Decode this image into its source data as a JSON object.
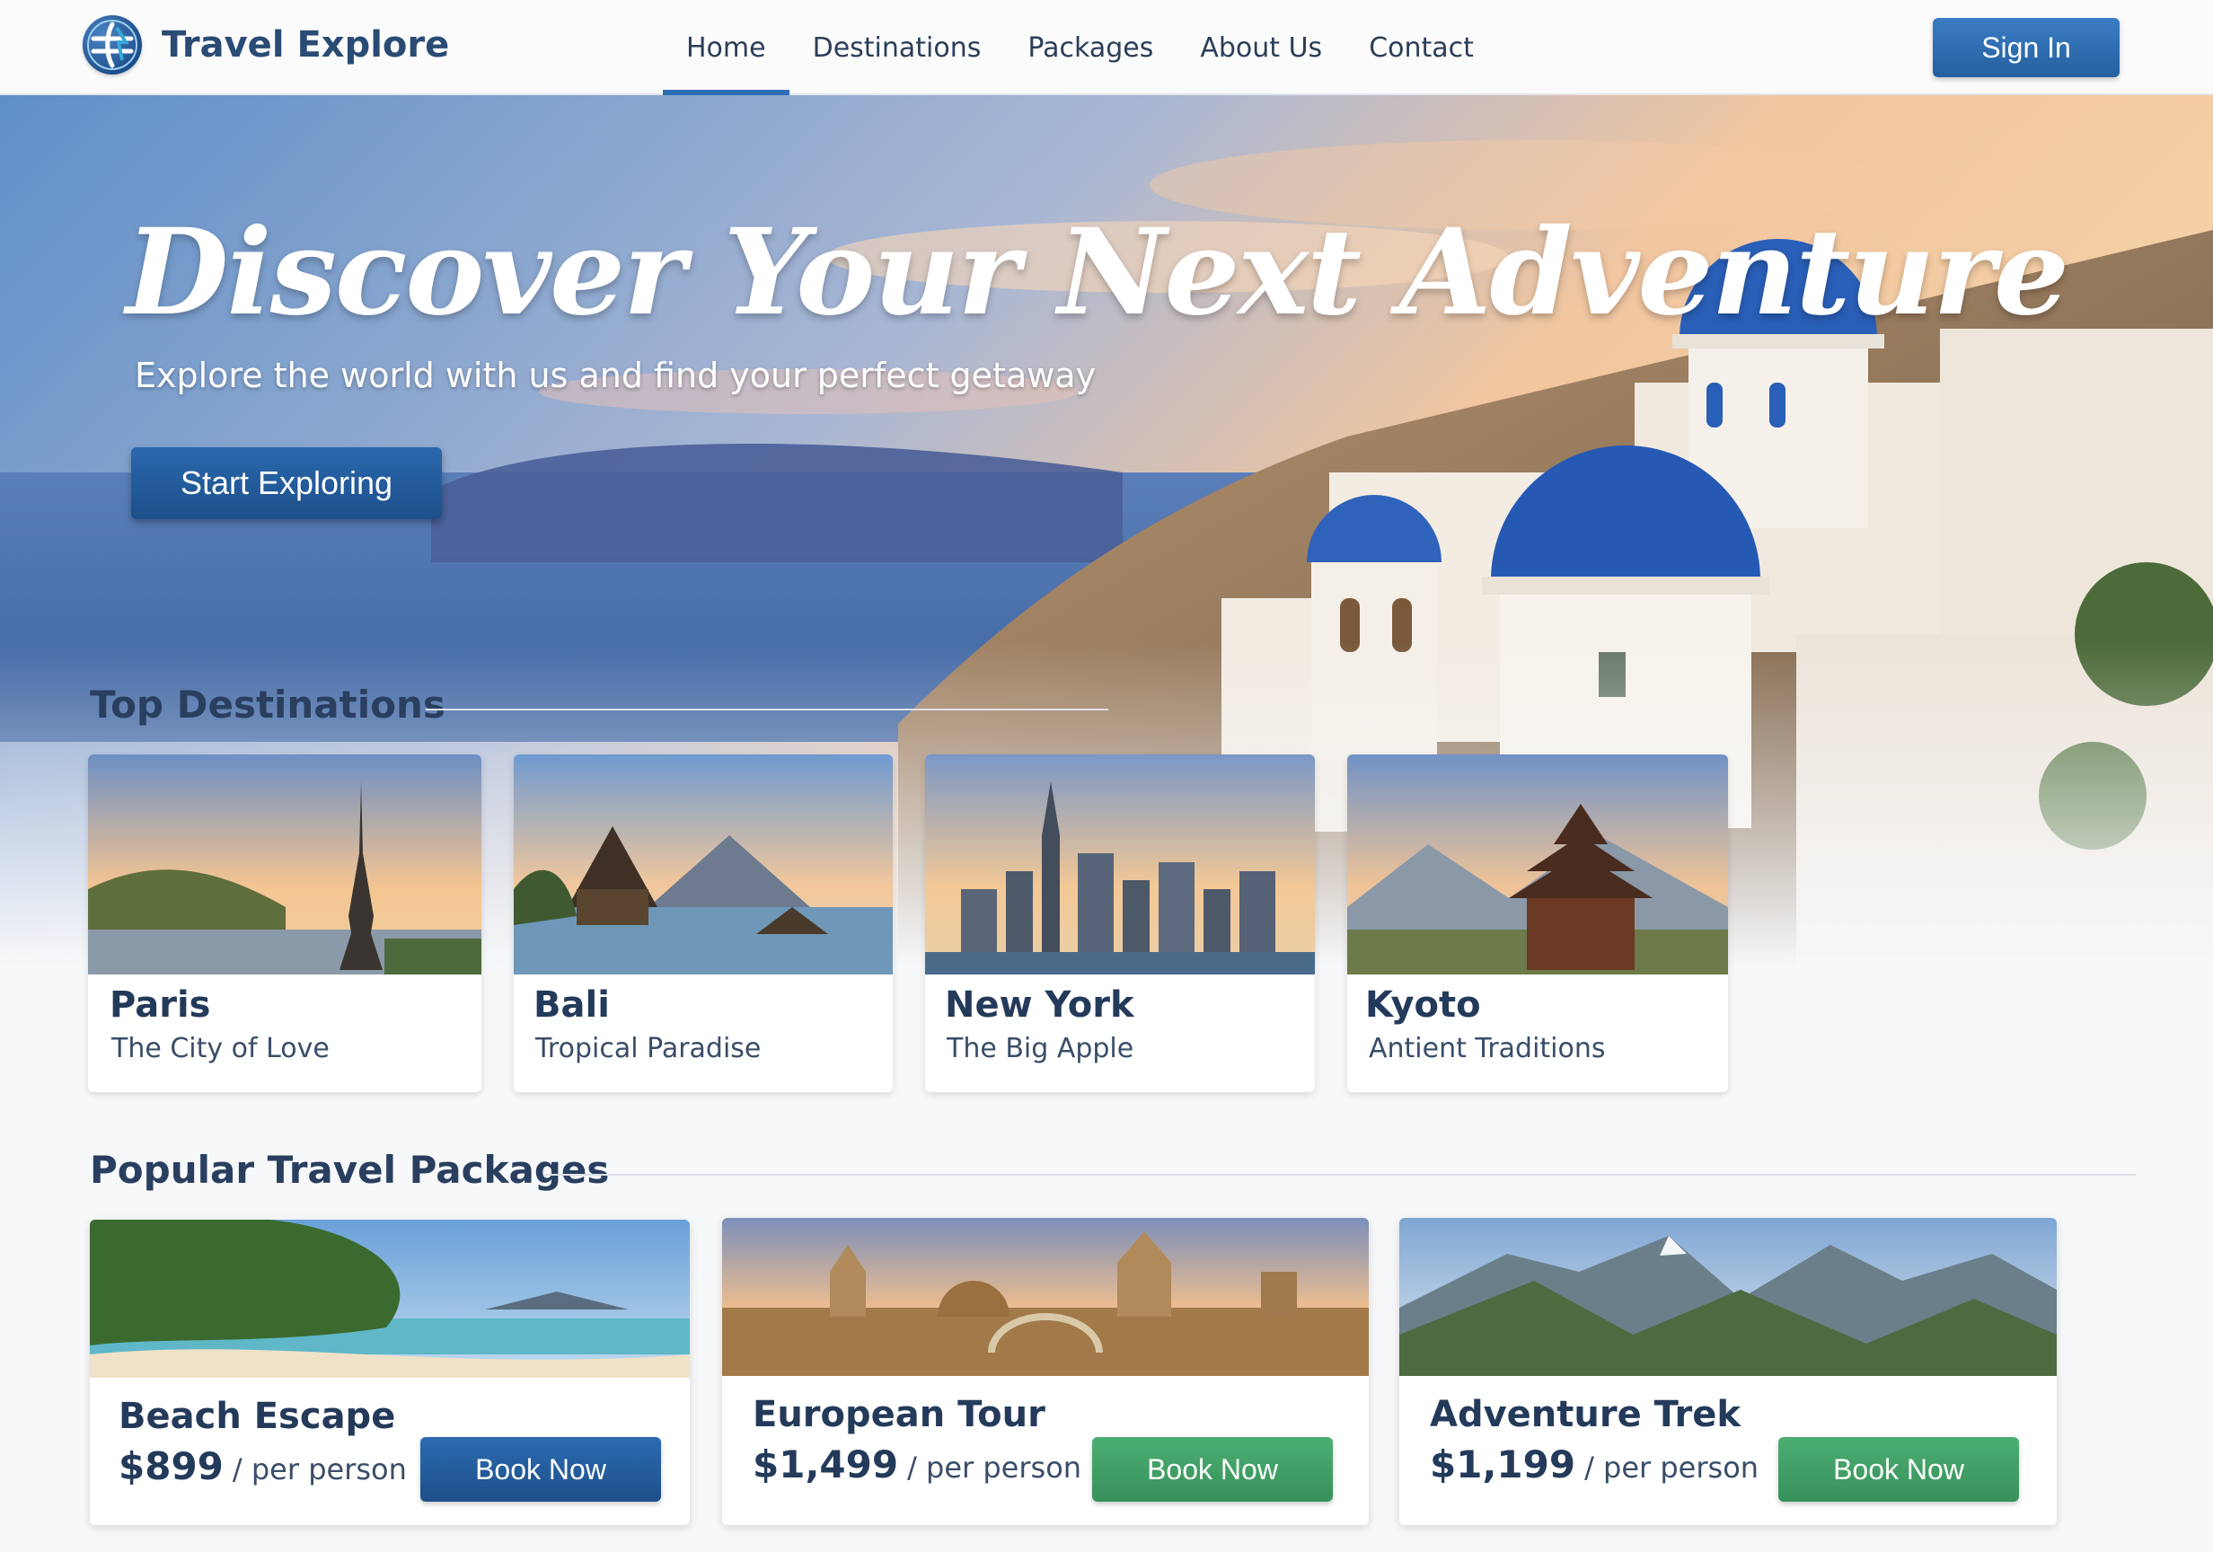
{
  "brand": {
    "name": "Travel Explore",
    "logo_icon": "globe-icon"
  },
  "nav": {
    "items": [
      {
        "label": "Home",
        "active": true
      },
      {
        "label": "Destinations",
        "active": false
      },
      {
        "label": "Packages",
        "active": false
      },
      {
        "label": "About Us",
        "active": false
      },
      {
        "label": "Contact",
        "active": false
      }
    ],
    "sign_in_label": "Sign In"
  },
  "hero": {
    "title": "Discover Your Next Adventure",
    "subtitle": "Explore the world with us and find your perfect getaway",
    "cta_label": "Start Exploring"
  },
  "top_destinations": {
    "title": "Top Destinations",
    "items": [
      {
        "name": "Paris",
        "tagline": "The City of Love"
      },
      {
        "name": "Bali",
        "tagline": "Tropical Paradise"
      },
      {
        "name": "New York",
        "tagline": "The Big Apple"
      },
      {
        "name": "Kyoto",
        "tagline": "Antient Traditions"
      }
    ]
  },
  "packages": {
    "title": "Popular Travel Packages",
    "price_unit": "/ per person",
    "items": [
      {
        "name": "Beach Escape",
        "price": "$899",
        "button_label": "Book Now",
        "button_color": "#2c6bb0"
      },
      {
        "name": "European Tour",
        "price": "$1,499",
        "button_label": "Book Now",
        "button_color": "#4cae72"
      },
      {
        "name": "Adventure Trek",
        "price": "$1,199",
        "button_label": "Book Now",
        "button_color": "#4cae72"
      }
    ]
  },
  "colors": {
    "primary": "#2e6db4",
    "accent_green": "#4cae72",
    "heading": "#2a3f5f"
  }
}
